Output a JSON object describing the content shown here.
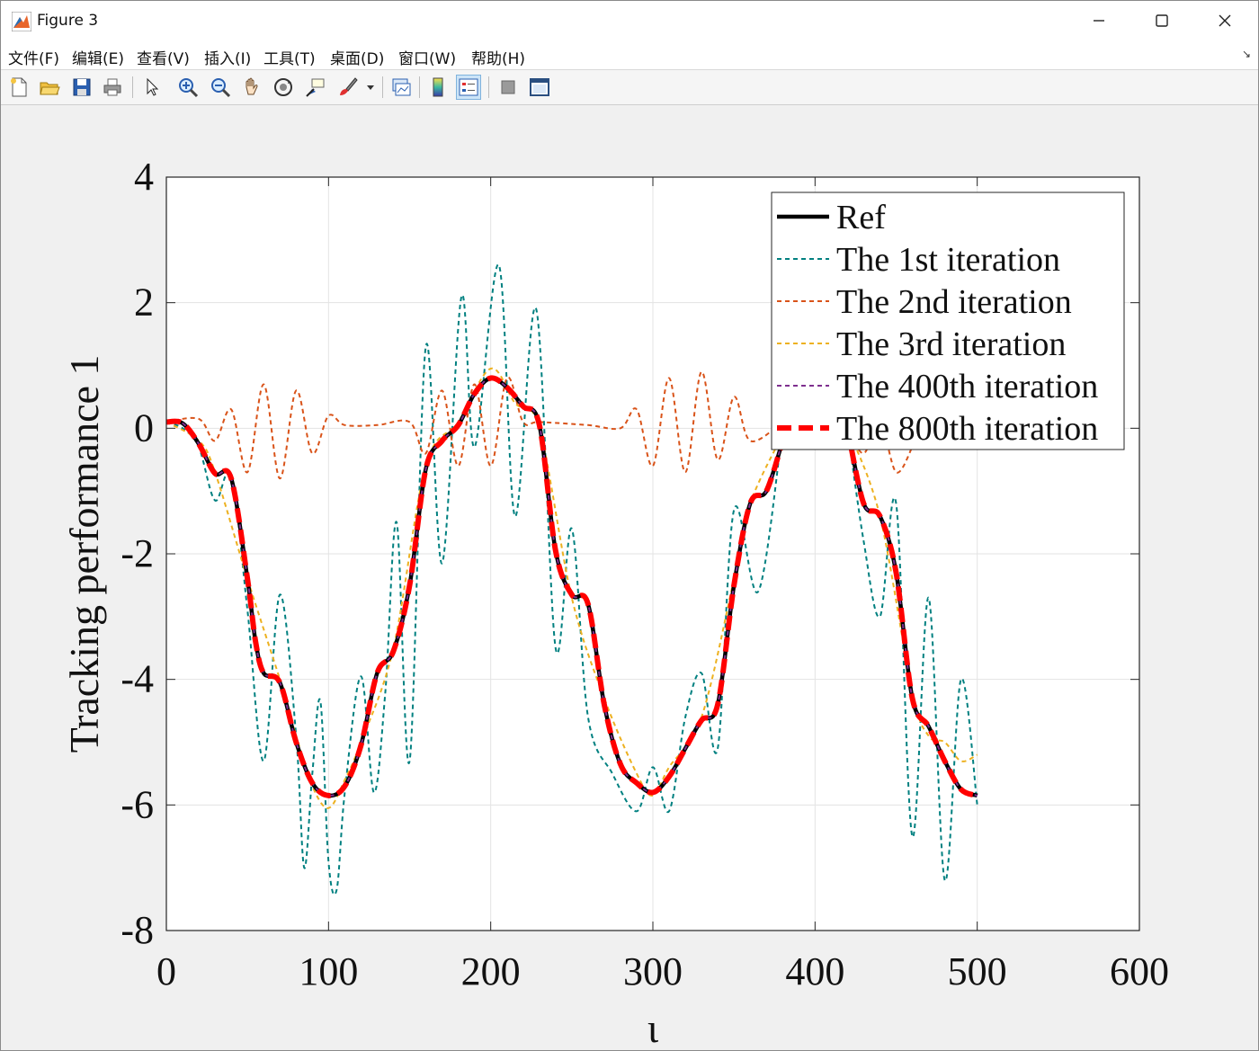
{
  "window": {
    "title": "Figure 3",
    "minimize_icon": "minimize-icon",
    "maximize_icon": "maximize-icon",
    "close_icon": "close-icon"
  },
  "menu": {
    "items": [
      "文件(F)",
      "编辑(E)",
      "查看(V)",
      "插入(I)",
      "工具(T)",
      "桌面(D)",
      "窗口(W)",
      "帮助(H)"
    ]
  },
  "toolbar": {
    "buttons": [
      "new-figure-icon",
      "open-file-icon",
      "save-icon",
      "print-icon",
      "select-pointer-icon",
      "zoom-in-icon",
      "zoom-out-icon",
      "pan-hand-icon",
      "rotate-3d-icon",
      "data-cursor-icon",
      "brush-icon",
      "link-plot-icon",
      "colorbar-icon",
      "legend-icon",
      "hide-plot-tools-icon",
      "show-plot-tools-icon"
    ]
  },
  "colors": {
    "ref": "#000000",
    "iter1": "#008080",
    "iter2": "#d95319",
    "iter3": "#edb120",
    "iter400": "#7e2f8e",
    "iter800": "#ff0000",
    "grid": "#e3e3e3",
    "axes_bg": "#ffffff"
  },
  "chart_data": {
    "type": "line",
    "xlabel": "ι",
    "ylabel": "Tracking performance 1",
    "xlim": [
      0,
      600
    ],
    "ylim": [
      -8,
      4
    ],
    "xticks": [
      0,
      100,
      200,
      300,
      400,
      500,
      600
    ],
    "yticks": [
      -8,
      -6,
      -4,
      -2,
      0,
      2,
      4
    ],
    "grid": true,
    "legend_position": "top-right",
    "x_range": [
      0,
      500
    ],
    "series": [
      {
        "name": "Ref",
        "style": "solid",
        "color": "#000000",
        "points": [
          [
            0,
            0.1
          ],
          [
            10,
            0.08
          ],
          [
            20,
            -0.25
          ],
          [
            30,
            -0.72
          ],
          [
            40,
            -0.8
          ],
          [
            50,
            -2.4
          ],
          [
            55,
            -3.4
          ],
          [
            60,
            -3.9
          ],
          [
            70,
            -4.05
          ],
          [
            80,
            -5.0
          ],
          [
            90,
            -5.65
          ],
          [
            100,
            -5.85
          ],
          [
            110,
            -5.7
          ],
          [
            120,
            -5.05
          ],
          [
            130,
            -3.9
          ],
          [
            140,
            -3.55
          ],
          [
            150,
            -2.5
          ],
          [
            160,
            -0.65
          ],
          [
            170,
            -0.2
          ],
          [
            180,
            0.05
          ],
          [
            190,
            0.55
          ],
          [
            200,
            0.8
          ],
          [
            210,
            0.65
          ],
          [
            220,
            0.35
          ],
          [
            230,
            0.05
          ],
          [
            240,
            -1.95
          ],
          [
            250,
            -2.65
          ],
          [
            260,
            -2.8
          ],
          [
            270,
            -4.4
          ],
          [
            280,
            -5.35
          ],
          [
            290,
            -5.65
          ],
          [
            300,
            -5.8
          ],
          [
            310,
            -5.55
          ],
          [
            320,
            -5.1
          ],
          [
            330,
            -4.65
          ],
          [
            340,
            -4.4
          ],
          [
            350,
            -2.5
          ],
          [
            360,
            -1.2
          ],
          [
            370,
            -1.0
          ],
          [
            380,
            -0.2
          ]
        ]
      },
      {
        "name": "The 1st iteration",
        "style": "dashed",
        "color": "#008080",
        "points": [
          [
            0,
            0.1
          ],
          [
            10,
            0.0
          ],
          [
            20,
            -0.3
          ],
          [
            30,
            -1.15
          ],
          [
            40,
            -0.75
          ],
          [
            50,
            -2.9
          ],
          [
            60,
            -5.3
          ],
          [
            70,
            -2.65
          ],
          [
            80,
            -4.9
          ],
          [
            85,
            -7.0
          ],
          [
            90,
            -5.5
          ],
          [
            95,
            -4.35
          ],
          [
            100,
            -6.9
          ],
          [
            105,
            -7.35
          ],
          [
            110,
            -5.8
          ],
          [
            120,
            -3.95
          ],
          [
            128,
            -5.8
          ],
          [
            135,
            -4.2
          ],
          [
            142,
            -1.5
          ],
          [
            150,
            -5.3
          ],
          [
            160,
            1.3
          ],
          [
            170,
            -2.15
          ],
          [
            182,
            2.1
          ],
          [
            190,
            -0.3
          ],
          [
            205,
            2.6
          ],
          [
            215,
            -1.4
          ],
          [
            228,
            1.9
          ],
          [
            240,
            -3.5
          ],
          [
            250,
            -1.6
          ],
          [
            260,
            -4.6
          ],
          [
            275,
            -5.5
          ],
          [
            290,
            -6.1
          ],
          [
            300,
            -5.4
          ],
          [
            310,
            -6.1
          ],
          [
            320,
            -4.6
          ],
          [
            330,
            -3.9
          ],
          [
            340,
            -5.1
          ],
          [
            350,
            -1.3
          ],
          [
            365,
            -2.6
          ],
          [
            380,
            0.0
          ]
        ]
      },
      {
        "name": "The 2nd iteration",
        "style": "dashed",
        "color": "#d95319",
        "points": [
          [
            0,
            0.1
          ],
          [
            20,
            0.15
          ],
          [
            30,
            -0.2
          ],
          [
            40,
            0.3
          ],
          [
            50,
            -0.7
          ],
          [
            60,
            0.7
          ],
          [
            70,
            -0.8
          ],
          [
            80,
            0.6
          ],
          [
            90,
            -0.4
          ],
          [
            100,
            0.2
          ],
          [
            110,
            0.05
          ],
          [
            130,
            0.05
          ],
          [
            150,
            0.1
          ],
          [
            160,
            -0.4
          ],
          [
            170,
            0.6
          ],
          [
            180,
            -0.6
          ],
          [
            190,
            0.7
          ],
          [
            200,
            -0.6
          ],
          [
            210,
            0.8
          ],
          [
            220,
            0.1
          ],
          [
            230,
            0.1
          ],
          [
            260,
            0.05
          ],
          [
            280,
            0.0
          ],
          [
            290,
            0.3
          ],
          [
            300,
            -0.6
          ],
          [
            310,
            0.8
          ],
          [
            320,
            -0.7
          ],
          [
            330,
            0.9
          ],
          [
            340,
            -0.5
          ],
          [
            350,
            0.5
          ],
          [
            360,
            -0.2
          ],
          [
            380,
            0.1
          ]
        ]
      },
      {
        "name": "The 3rd iteration",
        "style": "dashed",
        "color": "#edb120",
        "points": [
          [
            0,
            0.1
          ],
          [
            20,
            -0.2
          ],
          [
            30,
            -0.7
          ],
          [
            50,
            -2.4
          ],
          [
            70,
            -4.0
          ],
          [
            80,
            -4.9
          ],
          [
            90,
            -5.7
          ],
          [
            100,
            -6.05
          ],
          [
            110,
            -5.6
          ],
          [
            120,
            -5.0
          ],
          [
            140,
            -3.5
          ],
          [
            160,
            -0.6
          ],
          [
            180,
            0.1
          ],
          [
            200,
            0.95
          ],
          [
            215,
            0.4
          ],
          [
            230,
            0.0
          ],
          [
            250,
            -2.7
          ],
          [
            270,
            -4.3
          ],
          [
            290,
            -5.5
          ],
          [
            300,
            -5.85
          ],
          [
            310,
            -5.4
          ],
          [
            330,
            -4.6
          ],
          [
            350,
            -2.4
          ],
          [
            360,
            -1.2
          ],
          [
            380,
            -0.1
          ]
        ]
      },
      {
        "name": "The 400th iteration",
        "style": "dashed",
        "color": "#7e2f8e",
        "points": [
          [
            0,
            0.1
          ],
          [
            10,
            0.08
          ],
          [
            20,
            -0.25
          ],
          [
            30,
            -0.72
          ],
          [
            40,
            -0.8
          ],
          [
            50,
            -2.4
          ],
          [
            55,
            -3.4
          ],
          [
            60,
            -3.9
          ],
          [
            70,
            -4.05
          ],
          [
            80,
            -5.0
          ],
          [
            90,
            -5.65
          ],
          [
            100,
            -5.85
          ],
          [
            110,
            -5.7
          ],
          [
            120,
            -5.05
          ],
          [
            130,
            -3.9
          ],
          [
            140,
            -3.55
          ],
          [
            150,
            -2.5
          ],
          [
            160,
            -0.65
          ],
          [
            170,
            -0.2
          ],
          [
            180,
            0.05
          ],
          [
            190,
            0.55
          ],
          [
            200,
            0.8
          ],
          [
            210,
            0.65
          ],
          [
            220,
            0.35
          ],
          [
            230,
            0.05
          ],
          [
            240,
            -1.95
          ],
          [
            250,
            -2.65
          ],
          [
            260,
            -2.8
          ],
          [
            270,
            -4.4
          ],
          [
            280,
            -5.35
          ],
          [
            290,
            -5.65
          ],
          [
            300,
            -5.8
          ],
          [
            310,
            -5.55
          ],
          [
            320,
            -5.1
          ],
          [
            330,
            -4.65
          ],
          [
            340,
            -4.4
          ],
          [
            350,
            -2.5
          ],
          [
            360,
            -1.2
          ],
          [
            370,
            -1.0
          ],
          [
            380,
            -0.2
          ]
        ]
      },
      {
        "name": "The 800th iteration",
        "style": "dashed-thick",
        "color": "#ff0000",
        "points": [
          [
            0,
            0.1
          ],
          [
            10,
            0.08
          ],
          [
            20,
            -0.25
          ],
          [
            30,
            -0.72
          ],
          [
            40,
            -0.8
          ],
          [
            50,
            -2.4
          ],
          [
            55,
            -3.4
          ],
          [
            60,
            -3.9
          ],
          [
            70,
            -4.05
          ],
          [
            80,
            -5.0
          ],
          [
            90,
            -5.65
          ],
          [
            100,
            -5.85
          ],
          [
            110,
            -5.7
          ],
          [
            120,
            -5.05
          ],
          [
            130,
            -3.9
          ],
          [
            140,
            -3.55
          ],
          [
            150,
            -2.5
          ],
          [
            160,
            -0.65
          ],
          [
            170,
            -0.2
          ],
          [
            180,
            0.05
          ],
          [
            190,
            0.55
          ],
          [
            200,
            0.8
          ],
          [
            210,
            0.65
          ],
          [
            220,
            0.35
          ],
          [
            230,
            0.05
          ],
          [
            240,
            -1.95
          ],
          [
            250,
            -2.65
          ],
          [
            260,
            -2.8
          ],
          [
            270,
            -4.4
          ],
          [
            280,
            -5.35
          ],
          [
            290,
            -5.65
          ],
          [
            300,
            -5.8
          ],
          [
            310,
            -5.55
          ],
          [
            320,
            -5.1
          ],
          [
            330,
            -4.65
          ],
          [
            340,
            -4.4
          ],
          [
            350,
            -2.5
          ],
          [
            360,
            -1.2
          ],
          [
            370,
            -1.0
          ],
          [
            380,
            -0.2
          ]
        ]
      }
    ],
    "tail_segments": [
      {
        "series": "Ref",
        "points": [
          [
            420,
            0.0
          ],
          [
            430,
            -1.2
          ],
          [
            440,
            -1.4
          ],
          [
            450,
            -2.3
          ],
          [
            460,
            -4.3
          ],
          [
            470,
            -4.75
          ],
          [
            480,
            -5.3
          ],
          [
            490,
            -5.75
          ],
          [
            500,
            -5.85
          ]
        ]
      },
      {
        "series": "The 1st iteration",
        "points": [
          [
            420,
            0.0
          ],
          [
            430,
            -1.8
          ],
          [
            440,
            -3.0
          ],
          [
            450,
            -1.2
          ],
          [
            460,
            -6.5
          ],
          [
            470,
            -2.7
          ],
          [
            480,
            -7.2
          ],
          [
            490,
            -4.0
          ],
          [
            500,
            -6.0
          ]
        ]
      },
      {
        "series": "The 2nd iteration",
        "points": [
          [
            420,
            0.0
          ],
          [
            430,
            -0.4
          ],
          [
            440,
            0.1
          ],
          [
            450,
            -0.7
          ],
          [
            460,
            -0.3
          ]
        ]
      },
      {
        "series": "The 3rd iteration",
        "points": [
          [
            420,
            0.0
          ],
          [
            440,
            -1.4
          ],
          [
            460,
            -4.2
          ],
          [
            470,
            -4.9
          ],
          [
            480,
            -5.0
          ],
          [
            490,
            -5.3
          ],
          [
            500,
            -5.2
          ]
        ]
      },
      {
        "series": "The 400th iteration",
        "points": [
          [
            420,
            0.0
          ],
          [
            430,
            -1.2
          ],
          [
            440,
            -1.4
          ],
          [
            450,
            -2.3
          ],
          [
            460,
            -4.3
          ],
          [
            470,
            -4.75
          ],
          [
            480,
            -5.3
          ],
          [
            490,
            -5.75
          ],
          [
            500,
            -5.85
          ]
        ]
      },
      {
        "series": "The 800th iteration",
        "points": [
          [
            420,
            0.0
          ],
          [
            430,
            -1.2
          ],
          [
            440,
            -1.4
          ],
          [
            450,
            -2.3
          ],
          [
            460,
            -4.3
          ],
          [
            470,
            -4.75
          ],
          [
            480,
            -5.3
          ],
          [
            490,
            -5.75
          ],
          [
            500,
            -5.85
          ]
        ]
      }
    ]
  }
}
